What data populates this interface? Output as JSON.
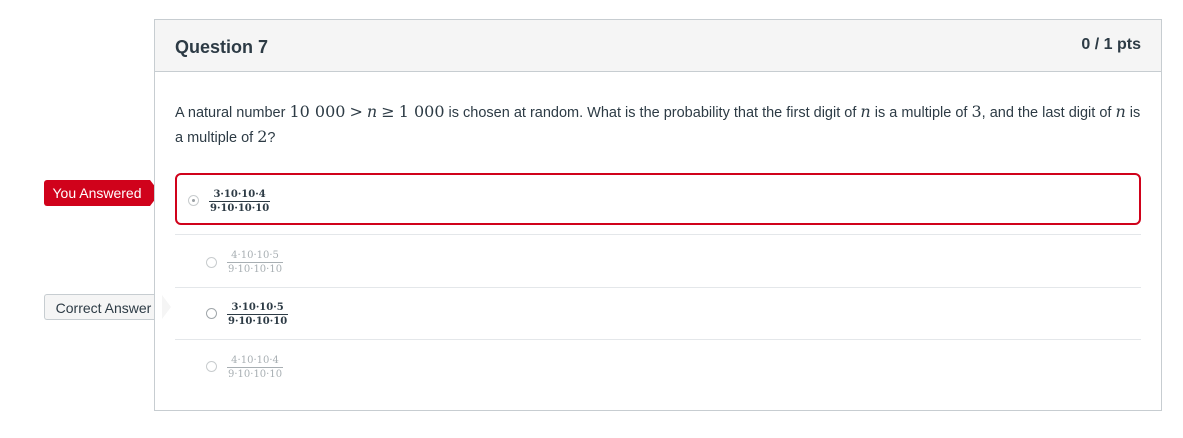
{
  "question": {
    "title": "Question 7",
    "points": "0 / 1 pts",
    "text_parts": {
      "p1": "A natural number ",
      "m1": "10 000",
      "m2": ">",
      "m3": "n",
      "m4": "≥",
      "m5": "1 000",
      "p2": " is chosen at random. What is the probability that the first digit of ",
      "m6": "n",
      "p3": " is a multiple of ",
      "m7": "3",
      "p4": ", and the last digit of ",
      "m8": "n",
      "p5": " is a multiple of ",
      "m9": "2",
      "p6": "?"
    }
  },
  "flags": {
    "you_answered": "You Answered",
    "correct_answer": "Correct Answer"
  },
  "answers": [
    {
      "numerator": "3·10·10·4",
      "denominator": "9·10·10·10",
      "selected": true,
      "status": "wrong"
    },
    {
      "numerator": "4·10·10·5",
      "denominator": "9·10·10·10",
      "selected": false,
      "status": "none"
    },
    {
      "numerator": "3·10·10·5",
      "denominator": "9·10·10·10",
      "selected": false,
      "status": "correct"
    },
    {
      "numerator": "4·10·10·4",
      "denominator": "9·10·10·10",
      "selected": false,
      "status": "none"
    }
  ],
  "colors": {
    "wrong": "#d0021b",
    "header_bg": "#f5f5f5",
    "border": "#c7cdd1",
    "text": "#2d3b45"
  }
}
